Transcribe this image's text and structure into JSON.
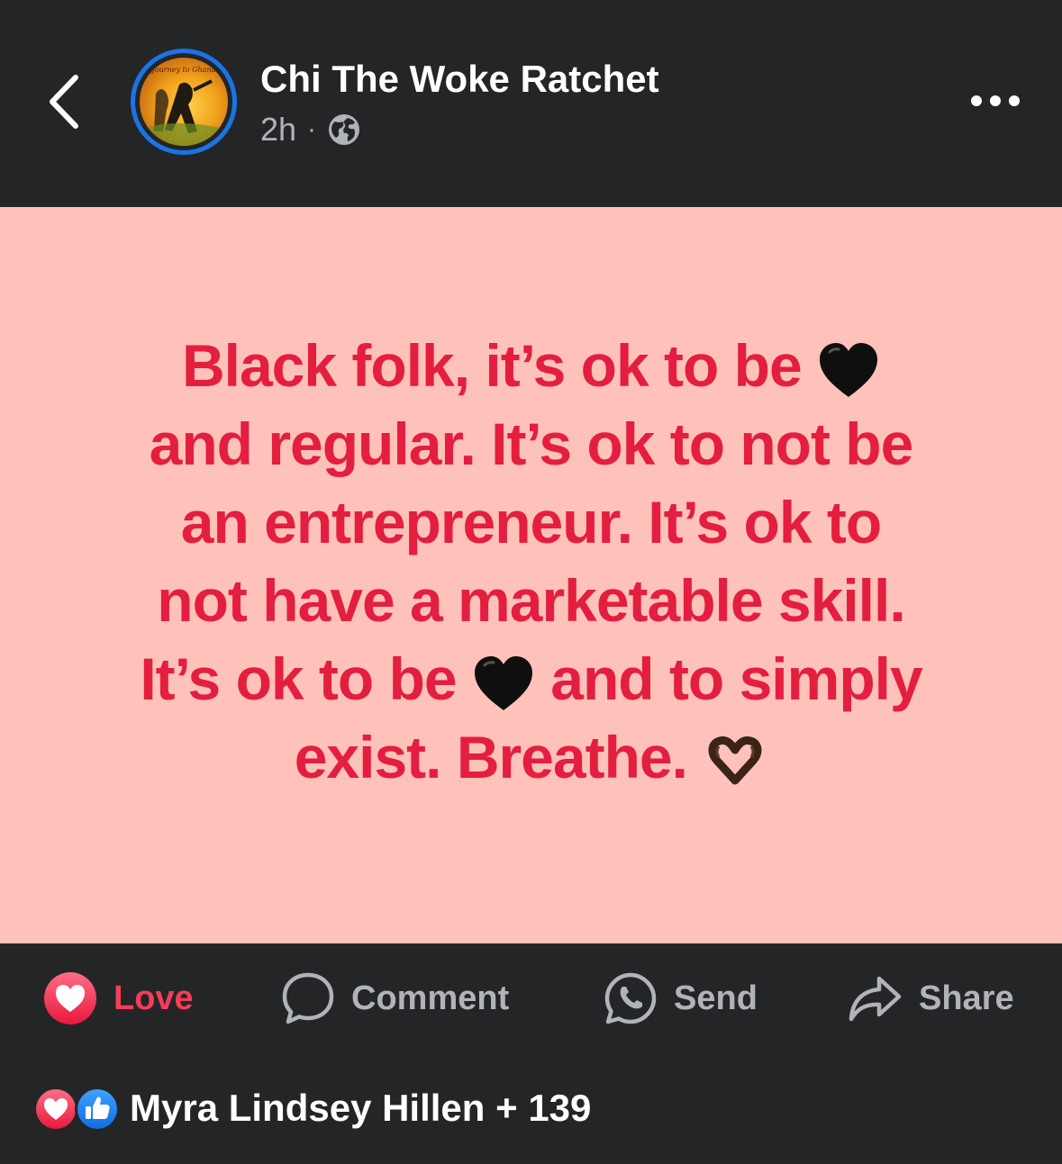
{
  "header": {
    "author_name": "Chi The Woke Ratchet",
    "time": "2h",
    "separator": "·",
    "privacy_icon": "globe-icon",
    "avatar_text": "Journey to Ghana"
  },
  "post": {
    "background_color": "#ffc2bb",
    "text_color": "#e41e3f",
    "lines": [
      "Black folk, it’s ok to be",
      "and regular. It’s ok to not be",
      "an entrepreneur. It’s ok to",
      "not have a marketable skill.",
      "It’s ok to be",
      "and to simply",
      "exist. Breathe."
    ],
    "emojis": [
      "black-heart-icon",
      "heart-hands-icon"
    ]
  },
  "actions": {
    "love": "Love",
    "comment": "Comment",
    "send": "Send",
    "share": "Share"
  },
  "reactions": {
    "summary": "Myra Lindsey Hillen + 139",
    "icons": [
      "love-reaction-icon",
      "like-reaction-icon"
    ]
  },
  "colors": {
    "background": "#242526",
    "love": "#f33e58",
    "like": "#1877f2",
    "muted": "#b0b3b8"
  }
}
